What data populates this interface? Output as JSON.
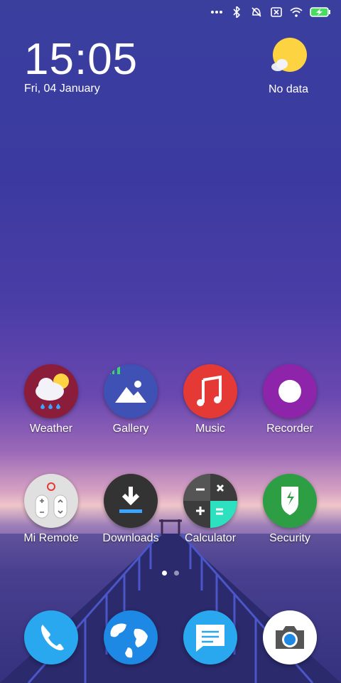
{
  "status": {
    "icons": [
      "more-dots-icon",
      "bluetooth-icon",
      "alarm-off-icon",
      "sim-none-icon",
      "wifi-icon",
      "battery-charging-icon"
    ]
  },
  "clock": {
    "time": "15:05",
    "date": "Fri, 04 January"
  },
  "weather": {
    "status": "No data"
  },
  "apps": [
    {
      "id": "weather",
      "label": "Weather"
    },
    {
      "id": "gallery",
      "label": "Gallery"
    },
    {
      "id": "music",
      "label": "Music"
    },
    {
      "id": "recorder",
      "label": "Recorder"
    },
    {
      "id": "mi-remote",
      "label": "Mi Remote"
    },
    {
      "id": "downloads",
      "label": "Downloads"
    },
    {
      "id": "calculator",
      "label": "Calculator"
    },
    {
      "id": "security",
      "label": "Security"
    }
  ],
  "dock": [
    {
      "id": "phone",
      "label": ""
    },
    {
      "id": "browser",
      "label": ""
    },
    {
      "id": "messages",
      "label": ""
    },
    {
      "id": "camera",
      "label": ""
    }
  ],
  "pages": {
    "count": 2,
    "current": 1
  },
  "colors": {
    "weather_bg": "#8b1c3a",
    "gallery_bg": "#3f51b5",
    "music_bg": "#e53935",
    "recorder_bg": "#8e24aa",
    "remote_bg": "#e0e0e0",
    "downloads_bg": "#333333",
    "calculator_bg": "#424242",
    "security_bg": "#2e9e44",
    "phone_bg": "#29a8f0",
    "browser_bg": "#1e88e5",
    "messages_bg": "#29a8f0",
    "camera_bg": "#ffffff"
  }
}
